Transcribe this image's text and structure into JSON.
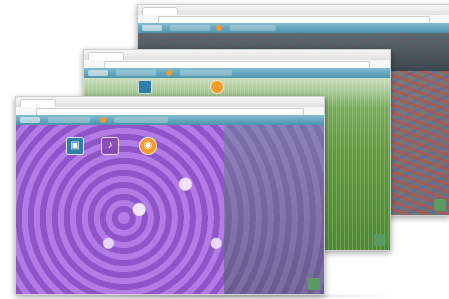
{
  "windows": [
    {
      "id": "w3",
      "tab_label": "",
      "content_theme": "tools-and-wires-photo",
      "accent_colors": [
        "#f39b2c",
        "#4e93ad"
      ]
    },
    {
      "id": "w2",
      "tab_label": "",
      "content_theme": "grass-photo",
      "accent_colors": [
        "#f39b2c",
        "#4e93ad"
      ]
    },
    {
      "id": "w1",
      "tab_label": "",
      "content_theme": "purple-flowers-photo",
      "icons": [
        {
          "name": "photo-icon",
          "glyph": "▣"
        },
        {
          "name": "music-icon",
          "glyph": "♪"
        },
        {
          "name": "video-icon",
          "glyph": "◉"
        }
      ],
      "accent_colors": [
        "#f39b2c",
        "#4e93ad"
      ]
    }
  ]
}
